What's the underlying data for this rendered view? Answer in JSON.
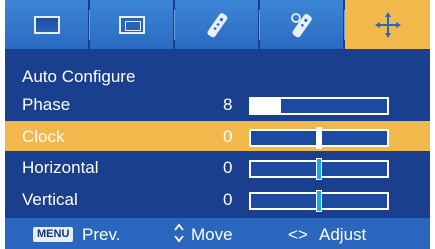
{
  "tabs": [
    {
      "icon": "picture-icon",
      "active": false
    },
    {
      "icon": "screen-icon",
      "active": false
    },
    {
      "icon": "remote-icon",
      "active": false
    },
    {
      "icon": "remote-settings-icon",
      "active": false
    },
    {
      "icon": "pc-position-icon",
      "active": true
    }
  ],
  "menu": {
    "title": "Auto Configure",
    "items": [
      {
        "label": "Phase",
        "value": "8",
        "level": 0.22,
        "style": "fill"
      },
      {
        "label": "Clock",
        "value": "0",
        "level": 0.5,
        "style": "marker",
        "selected": true
      },
      {
        "label": "Horizontal",
        "value": "0",
        "level": 0.5,
        "style": "marker"
      },
      {
        "label": "Vertical",
        "value": "0",
        "level": 0.5,
        "style": "marker"
      }
    ]
  },
  "footer": {
    "menu_key": "MENU",
    "prev": "Prev.",
    "move_icon": "up-down-arrows-icon",
    "move": "Move",
    "adjust_icon": "left-right-arrows-icon",
    "adjust_arrows": "<>",
    "adjust": "Adjust"
  },
  "colors": {
    "background": "#1a3f8e",
    "tab": "#2a6ac1",
    "highlight": "#f1b84c",
    "footer": "#2a66bd",
    "marker": "#1da6ea"
  }
}
